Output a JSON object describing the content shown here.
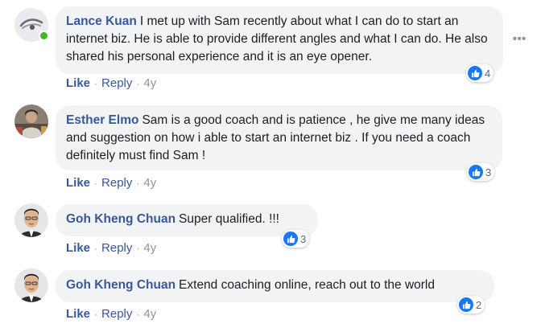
{
  "comments": [
    {
      "author": "Lance Kuan",
      "text": "I met up with Sam recently about what I can do to start an internet biz. He is able to provide different angles and what I can do. He also shared his personal experience and it is an eye opener.",
      "reactions": "4",
      "like_label": "Like",
      "reply_label": "Reply",
      "age": "4y",
      "online": true,
      "avatar_icon": "default-profile-icon"
    },
    {
      "author": "Esther Elmo",
      "text": "Sam is a good coach and is patience , he give me many ideas and suggestion on how i able to start an internet biz . If you need a coach definitely must find Sam !",
      "reactions": "3",
      "like_label": "Like",
      "reply_label": "Reply",
      "age": "4y",
      "avatar_icon": "profile-photo"
    },
    {
      "author": "Goh Kheng Chuan",
      "text": "Super qualified. !!!",
      "reactions": "3",
      "like_label": "Like",
      "reply_label": "Reply",
      "age": "4y",
      "avatar_icon": "profile-photo"
    },
    {
      "author": "Goh Kheng Chuan",
      "text": "Extend coaching online, reach out to the world",
      "reactions": "2",
      "like_label": "Like",
      "reply_label": "Reply",
      "age": "4y",
      "avatar_icon": "profile-photo"
    }
  ],
  "more_icon": "ellipsis-icon",
  "separator": "·",
  "colors": {
    "author": "#385898",
    "bubble": "#f2f3f5",
    "like_blue": "#1877f2",
    "online": "#42b72a",
    "meta": "#90949c"
  }
}
